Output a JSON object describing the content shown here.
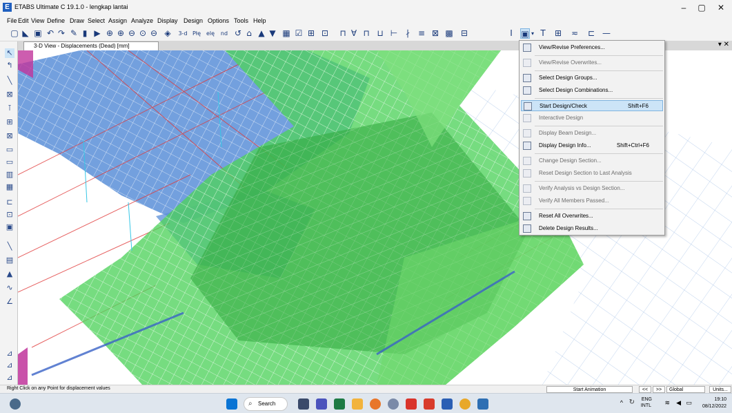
{
  "window": {
    "title": "ETABS Ultimate C 19.1.0 - lengkap lantai",
    "app_icon": "E",
    "minimize": "–",
    "maximize": "▢",
    "close": "✕"
  },
  "menu": [
    "File",
    "Edit",
    "View",
    "Define",
    "Draw",
    "Select",
    "Assign",
    "Analyze",
    "Display",
    "Design",
    "Options",
    "Tools",
    "Help"
  ],
  "toolbar": {
    "icons": [
      "new-icon",
      "open-icon",
      "save-icon",
      "undo-icon",
      "redo-icon",
      "pencil-icon",
      "lock-icon",
      "run-icon",
      "zoom-icon",
      "zoom-in-icon",
      "zoom-out-icon",
      "zoom-window-icon",
      "pan-icon",
      "3d-view-icon",
      "plan-view-icon",
      "elevation-view-icon",
      "rotate-icon",
      "perspective-icon",
      "up-icon",
      "down-icon",
      "grid-icon",
      "select-icon",
      "deselect-icon",
      "beam-icon",
      "column-icon",
      "brace-icon",
      "design-icon"
    ],
    "labels": [
      "3-d",
      "Płę",
      "elę",
      "nd"
    ]
  },
  "view_tab": {
    "title": "3-D View  - Displacements (Dead)  [mm]",
    "close": "▾ ✕"
  },
  "dropdown": {
    "items": [
      {
        "label": "View/Revise Preferences...",
        "shortcut": "",
        "enabled": true
      },
      {
        "label": "View/Revise Overwrites...",
        "shortcut": "",
        "enabled": false
      },
      {
        "label": "Select Design Groups...",
        "shortcut": "",
        "enabled": true
      },
      {
        "label": "Select Design Combinations...",
        "shortcut": "",
        "enabled": true
      },
      {
        "label": "Start Design/Check",
        "shortcut": "Shift+F6",
        "enabled": true,
        "highlighted": true
      },
      {
        "label": "Interactive Design",
        "shortcut": "",
        "enabled": false
      },
      {
        "label": "Display Beam Design...",
        "shortcut": "",
        "enabled": false
      },
      {
        "label": "Display Design Info...",
        "shortcut": "Shift+Ctrl+F6",
        "enabled": true
      },
      {
        "label": "Change Design Section...",
        "shortcut": "",
        "enabled": false
      },
      {
        "label": "Reset Design Section to Last Analysis",
        "shortcut": "",
        "enabled": false
      },
      {
        "label": "Verify Analysis vs Design Section...",
        "shortcut": "",
        "enabled": false
      },
      {
        "label": "Verify All Members Passed...",
        "shortcut": "",
        "enabled": false
      },
      {
        "label": "Reset All Overwrites...",
        "shortcut": "",
        "enabled": true
      },
      {
        "label": "Delete Design Results...",
        "shortcut": "",
        "enabled": true
      }
    ]
  },
  "status": {
    "text": "Right Click on any Point for displacement values",
    "animation_button": "Start Animation",
    "prev": "<<",
    "next": ">>",
    "coord_system": "Global",
    "units": "Units..."
  },
  "taskbar": {
    "search_placeholder": "Search",
    "lang_top": "ENG",
    "lang_bottom": "INTL",
    "time": "19:10",
    "date": "08/12/2022"
  }
}
